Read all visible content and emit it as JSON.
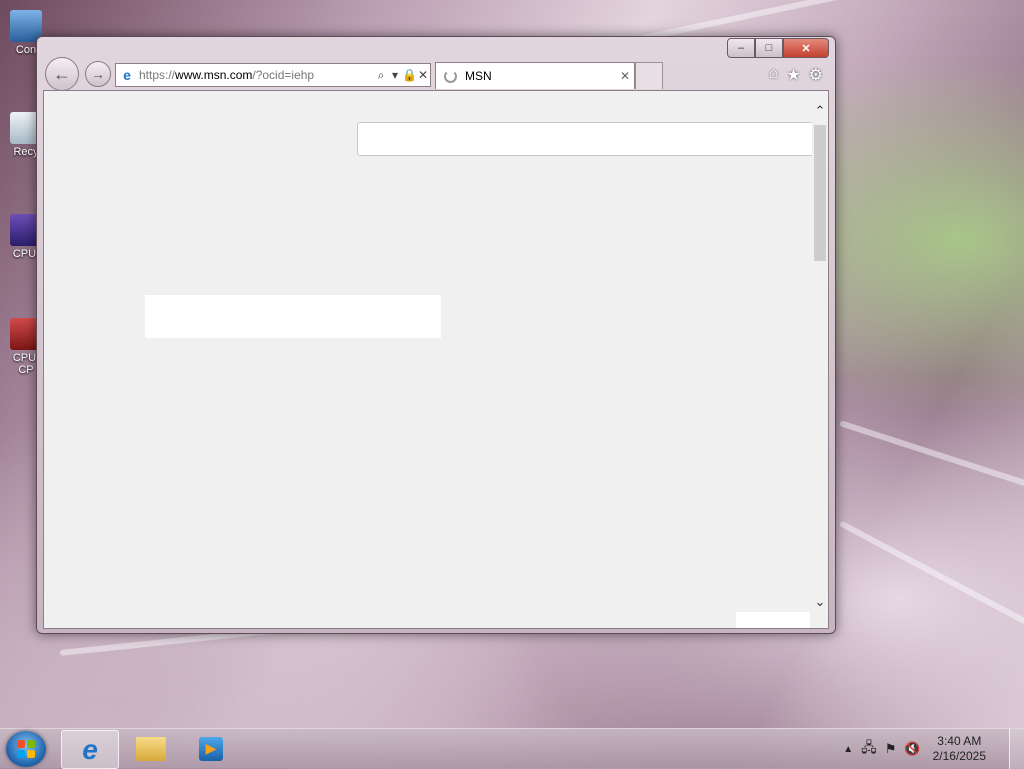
{
  "desktop": {
    "icons": [
      {
        "label": "Con",
        "icon": "computer-icon"
      },
      {
        "label": "Recy",
        "icon": "recycle-bin-icon"
      },
      {
        "label": "CPUI",
        "icon": "cpuid-icon"
      },
      {
        "label": "CPUI",
        "label2": "CP",
        "icon": "cpuid-cpu-icon"
      }
    ]
  },
  "browser": {
    "address": {
      "scheme": "https://",
      "host": "www.msn.com",
      "path": "/?ocid=iehp"
    },
    "tab": {
      "title": "MSN",
      "state": "loading"
    },
    "window_controls": {
      "minimize": "–",
      "maximize": "□",
      "close": "✕"
    },
    "nav": {
      "back": "←",
      "forward": "→"
    },
    "tools": {
      "home": "⌂",
      "favorites": "★",
      "settings": "⚙"
    },
    "scroll": {
      "up": "⌃",
      "down": "⌄"
    }
  },
  "taskbar": {
    "pinned": [
      {
        "name": "internet-explorer-icon",
        "active": true
      },
      {
        "name": "file-explorer-icon",
        "active": false
      },
      {
        "name": "media-player-icon",
        "active": false
      }
    ],
    "tray": {
      "time": "3:40 AM",
      "date": "2/16/2025"
    }
  },
  "colors": {
    "ie_blue": "#1f74c9",
    "close_red": "#c4402e",
    "content_bg": "#f0f0f0"
  }
}
